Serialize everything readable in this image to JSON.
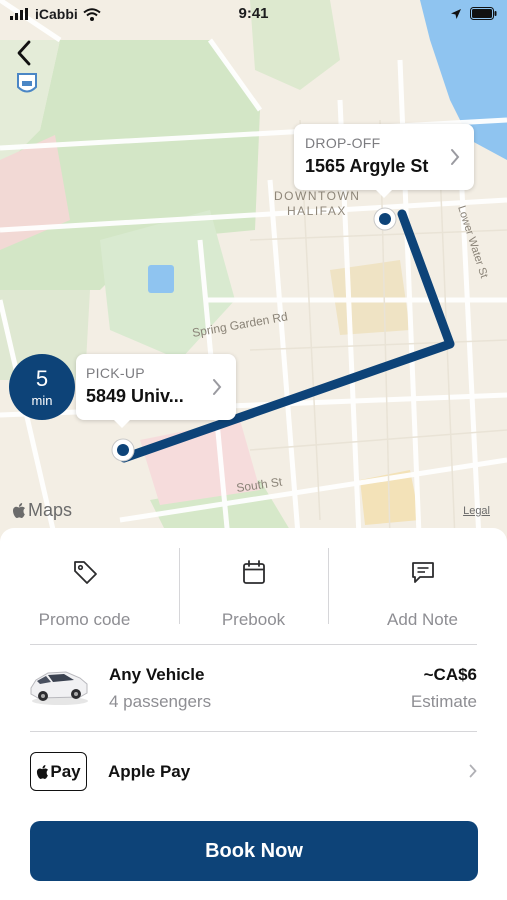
{
  "status_bar": {
    "carrier": "iCabbi",
    "time": "9:41"
  },
  "map": {
    "district_label_line1": "DOWNTOWN",
    "district_label_line2": "HALIFAX",
    "streets": [
      "Spring Garden Rd",
      "South St",
      "Lower Water St"
    ],
    "route_color": "#0d4378",
    "attribution": "Maps",
    "legal": "Legal"
  },
  "dropoff": {
    "caption": "DROP-OFF",
    "address": "1565 Argyle St"
  },
  "pickup": {
    "caption": "PICK-UP",
    "address": "5849 Univ..."
  },
  "eta": {
    "value": "5",
    "unit": "min"
  },
  "actions": [
    {
      "label": "Promo code",
      "icon": "tag-icon"
    },
    {
      "label": "Prebook",
      "icon": "calendar-icon"
    },
    {
      "label": "Add Note",
      "icon": "note-icon"
    }
  ],
  "vehicle": {
    "name": "Any Vehicle",
    "capacity": "4 passengers",
    "price": "~CA$6",
    "price_note": "Estimate"
  },
  "payment": {
    "badge": "Pay",
    "method": "Apple Pay"
  },
  "book_button": {
    "label": "Book Now",
    "color": "#0d4378"
  }
}
